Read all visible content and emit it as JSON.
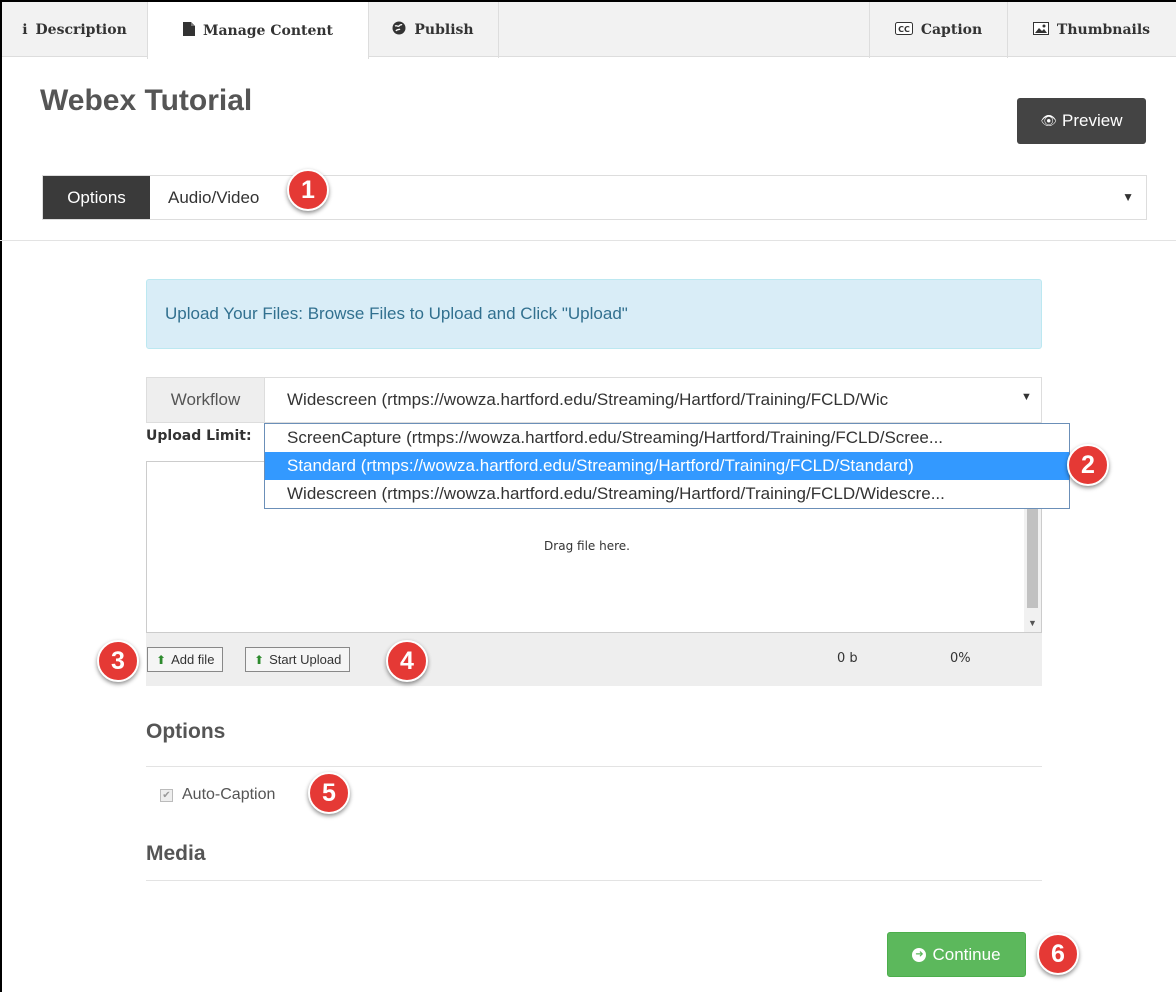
{
  "tabs": [
    {
      "label": "Description",
      "icon": "info-icon"
    },
    {
      "label": "Manage Content",
      "icon": "file-icon"
    },
    {
      "label": "Publish",
      "icon": "globe-icon"
    },
    {
      "label": "Caption",
      "icon": "cc-icon"
    },
    {
      "label": "Thumbnails",
      "icon": "image-icon"
    }
  ],
  "title": "Webex Tutorial",
  "preview_label": "Preview",
  "options_select": {
    "label": "Options",
    "value": "Audio/Video"
  },
  "alert_text": "Upload Your Files: Browse Files to Upload and Click \"Upload\"",
  "workflow": {
    "label": "Workflow",
    "value": "Widescreen (rtmps://wowza.hartford.edu/Streaming/Hartford/Training/FCLD/Wic",
    "options": [
      "ScreenCapture (rtmps://wowza.hartford.edu/Streaming/Hartford/Training/FCLD/Scree...",
      "Standard (rtmps://wowza.hartford.edu/Streaming/Hartford/Training/FCLD/Standard)",
      "Widescreen (rtmps://wowza.hartford.edu/Streaming/Hartford/Training/FCLD/Widescre..."
    ],
    "highlighted_index": 1
  },
  "upload_limit_label": "Upload Limit:",
  "dropzone_text": "Drag file here.",
  "toolbar": {
    "add_file": "Add file",
    "start_upload": "Start Upload",
    "size": "0 b",
    "percent": "0%"
  },
  "options_heading": "Options",
  "auto_caption": {
    "label": "Auto-Caption",
    "checked": true
  },
  "media_heading": "Media",
  "continue_label": "Continue",
  "callouts": [
    "1",
    "2",
    "3",
    "4",
    "5",
    "6"
  ],
  "colors": {
    "accent_dark": "#444444",
    "info_bg": "#d9edf7",
    "info_text": "#31708f",
    "highlight": "#3399ff",
    "success": "#5cb85c",
    "callout": "#e53935"
  }
}
